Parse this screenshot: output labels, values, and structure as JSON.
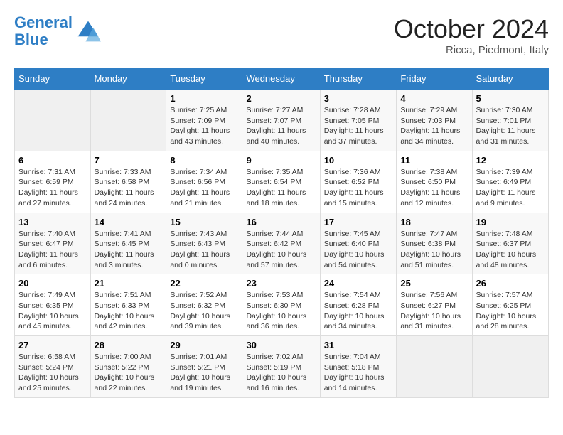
{
  "header": {
    "logo_line1": "General",
    "logo_line2": "Blue",
    "month": "October 2024",
    "location": "Ricca, Piedmont, Italy"
  },
  "days_of_week": [
    "Sunday",
    "Monday",
    "Tuesday",
    "Wednesday",
    "Thursday",
    "Friday",
    "Saturday"
  ],
  "weeks": [
    [
      {
        "day": "",
        "sunrise": "",
        "sunset": "",
        "daylight": ""
      },
      {
        "day": "",
        "sunrise": "",
        "sunset": "",
        "daylight": ""
      },
      {
        "day": "1",
        "sunrise": "Sunrise: 7:25 AM",
        "sunset": "Sunset: 7:09 PM",
        "daylight": "Daylight: 11 hours and 43 minutes."
      },
      {
        "day": "2",
        "sunrise": "Sunrise: 7:27 AM",
        "sunset": "Sunset: 7:07 PM",
        "daylight": "Daylight: 11 hours and 40 minutes."
      },
      {
        "day": "3",
        "sunrise": "Sunrise: 7:28 AM",
        "sunset": "Sunset: 7:05 PM",
        "daylight": "Daylight: 11 hours and 37 minutes."
      },
      {
        "day": "4",
        "sunrise": "Sunrise: 7:29 AM",
        "sunset": "Sunset: 7:03 PM",
        "daylight": "Daylight: 11 hours and 34 minutes."
      },
      {
        "day": "5",
        "sunrise": "Sunrise: 7:30 AM",
        "sunset": "Sunset: 7:01 PM",
        "daylight": "Daylight: 11 hours and 31 minutes."
      }
    ],
    [
      {
        "day": "6",
        "sunrise": "Sunrise: 7:31 AM",
        "sunset": "Sunset: 6:59 PM",
        "daylight": "Daylight: 11 hours and 27 minutes."
      },
      {
        "day": "7",
        "sunrise": "Sunrise: 7:33 AM",
        "sunset": "Sunset: 6:58 PM",
        "daylight": "Daylight: 11 hours and 24 minutes."
      },
      {
        "day": "8",
        "sunrise": "Sunrise: 7:34 AM",
        "sunset": "Sunset: 6:56 PM",
        "daylight": "Daylight: 11 hours and 21 minutes."
      },
      {
        "day": "9",
        "sunrise": "Sunrise: 7:35 AM",
        "sunset": "Sunset: 6:54 PM",
        "daylight": "Daylight: 11 hours and 18 minutes."
      },
      {
        "day": "10",
        "sunrise": "Sunrise: 7:36 AM",
        "sunset": "Sunset: 6:52 PM",
        "daylight": "Daylight: 11 hours and 15 minutes."
      },
      {
        "day": "11",
        "sunrise": "Sunrise: 7:38 AM",
        "sunset": "Sunset: 6:50 PM",
        "daylight": "Daylight: 11 hours and 12 minutes."
      },
      {
        "day": "12",
        "sunrise": "Sunrise: 7:39 AM",
        "sunset": "Sunset: 6:49 PM",
        "daylight": "Daylight: 11 hours and 9 minutes."
      }
    ],
    [
      {
        "day": "13",
        "sunrise": "Sunrise: 7:40 AM",
        "sunset": "Sunset: 6:47 PM",
        "daylight": "Daylight: 11 hours and 6 minutes."
      },
      {
        "day": "14",
        "sunrise": "Sunrise: 7:41 AM",
        "sunset": "Sunset: 6:45 PM",
        "daylight": "Daylight: 11 hours and 3 minutes."
      },
      {
        "day": "15",
        "sunrise": "Sunrise: 7:43 AM",
        "sunset": "Sunset: 6:43 PM",
        "daylight": "Daylight: 11 hours and 0 minutes."
      },
      {
        "day": "16",
        "sunrise": "Sunrise: 7:44 AM",
        "sunset": "Sunset: 6:42 PM",
        "daylight": "Daylight: 10 hours and 57 minutes."
      },
      {
        "day": "17",
        "sunrise": "Sunrise: 7:45 AM",
        "sunset": "Sunset: 6:40 PM",
        "daylight": "Daylight: 10 hours and 54 minutes."
      },
      {
        "day": "18",
        "sunrise": "Sunrise: 7:47 AM",
        "sunset": "Sunset: 6:38 PM",
        "daylight": "Daylight: 10 hours and 51 minutes."
      },
      {
        "day": "19",
        "sunrise": "Sunrise: 7:48 AM",
        "sunset": "Sunset: 6:37 PM",
        "daylight": "Daylight: 10 hours and 48 minutes."
      }
    ],
    [
      {
        "day": "20",
        "sunrise": "Sunrise: 7:49 AM",
        "sunset": "Sunset: 6:35 PM",
        "daylight": "Daylight: 10 hours and 45 minutes."
      },
      {
        "day": "21",
        "sunrise": "Sunrise: 7:51 AM",
        "sunset": "Sunset: 6:33 PM",
        "daylight": "Daylight: 10 hours and 42 minutes."
      },
      {
        "day": "22",
        "sunrise": "Sunrise: 7:52 AM",
        "sunset": "Sunset: 6:32 PM",
        "daylight": "Daylight: 10 hours and 39 minutes."
      },
      {
        "day": "23",
        "sunrise": "Sunrise: 7:53 AM",
        "sunset": "Sunset: 6:30 PM",
        "daylight": "Daylight: 10 hours and 36 minutes."
      },
      {
        "day": "24",
        "sunrise": "Sunrise: 7:54 AM",
        "sunset": "Sunset: 6:28 PM",
        "daylight": "Daylight: 10 hours and 34 minutes."
      },
      {
        "day": "25",
        "sunrise": "Sunrise: 7:56 AM",
        "sunset": "Sunset: 6:27 PM",
        "daylight": "Daylight: 10 hours and 31 minutes."
      },
      {
        "day": "26",
        "sunrise": "Sunrise: 7:57 AM",
        "sunset": "Sunset: 6:25 PM",
        "daylight": "Daylight: 10 hours and 28 minutes."
      }
    ],
    [
      {
        "day": "27",
        "sunrise": "Sunrise: 6:58 AM",
        "sunset": "Sunset: 5:24 PM",
        "daylight": "Daylight: 10 hours and 25 minutes."
      },
      {
        "day": "28",
        "sunrise": "Sunrise: 7:00 AM",
        "sunset": "Sunset: 5:22 PM",
        "daylight": "Daylight: 10 hours and 22 minutes."
      },
      {
        "day": "29",
        "sunrise": "Sunrise: 7:01 AM",
        "sunset": "Sunset: 5:21 PM",
        "daylight": "Daylight: 10 hours and 19 minutes."
      },
      {
        "day": "30",
        "sunrise": "Sunrise: 7:02 AM",
        "sunset": "Sunset: 5:19 PM",
        "daylight": "Daylight: 10 hours and 16 minutes."
      },
      {
        "day": "31",
        "sunrise": "Sunrise: 7:04 AM",
        "sunset": "Sunset: 5:18 PM",
        "daylight": "Daylight: 10 hours and 14 minutes."
      },
      {
        "day": "",
        "sunrise": "",
        "sunset": "",
        "daylight": ""
      },
      {
        "day": "",
        "sunrise": "",
        "sunset": "",
        "daylight": ""
      }
    ]
  ]
}
